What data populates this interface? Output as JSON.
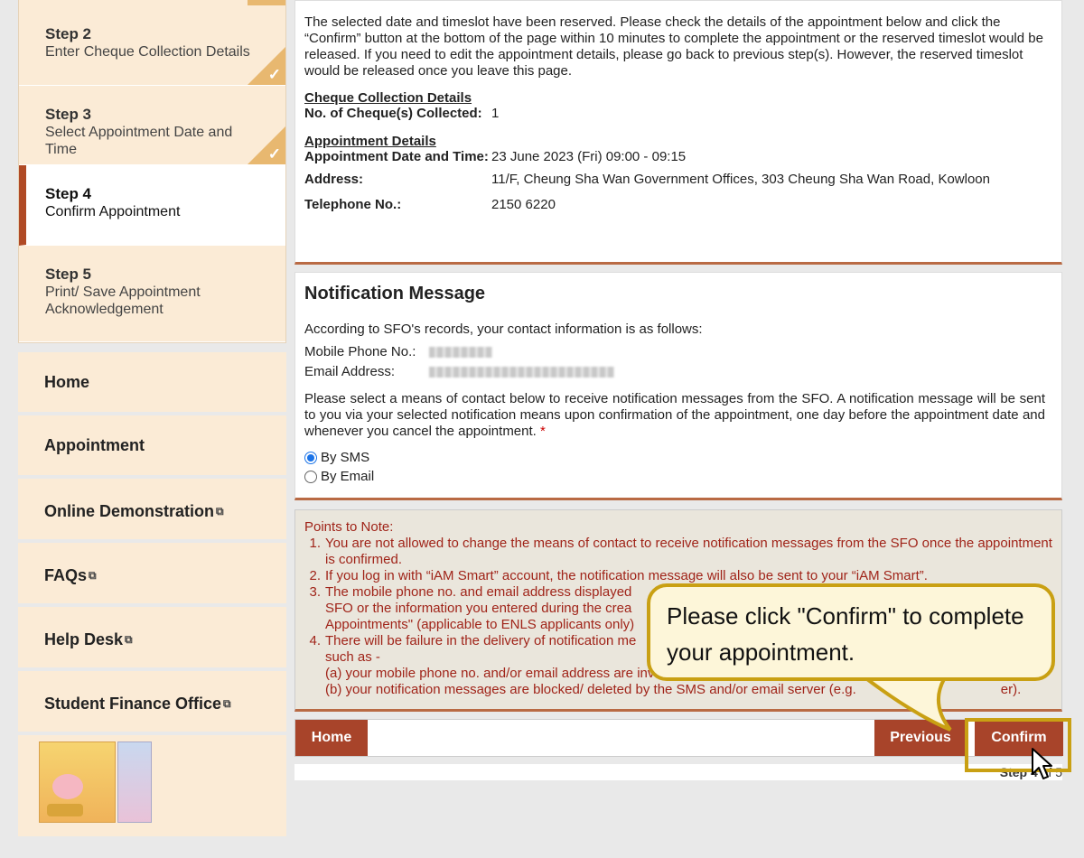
{
  "sidebar": {
    "steps": [
      {
        "num": "Step 2",
        "desc": "Enter Cheque Collection Details",
        "done": true
      },
      {
        "num": "Step 3",
        "desc": "Select Appointment Date and Time",
        "done": true
      },
      {
        "num": "Step 4",
        "desc": "Confirm Appointment",
        "active": true
      },
      {
        "num": "Step 5",
        "desc": "Print/ Save Appointment Acknowledgement"
      }
    ],
    "menu": {
      "home": "Home",
      "appointment": "Appointment",
      "demo": "Online Demonstration",
      "faqs": "FAQs",
      "help": "Help Desk",
      "sfo": "Student Finance Office"
    }
  },
  "main": {
    "intro": "The selected date and timeslot have been reserved. Please check the details of the appointment below and click the “Confirm” button at the bottom of the page within 10 minutes to complete the appointment or the reserved timeslot would be released. If you need to edit the appointment details, please go back to previous step(s). However, the reserved timeslot would be released once you leave this page.",
    "cheque_title": "Cheque Collection Details",
    "cheque_label": "No. of Cheque(s) Collected:",
    "cheque_value": "1",
    "appt_title": "Appointment Details",
    "date_label": "Appointment Date and Time:",
    "date_value": "23 June 2023 (Fri) 09:00 - 09:15",
    "address_label": "Address:",
    "address_value": "11/F, Cheung Sha Wan Government Offices, 303 Cheung Sha Wan Road, Kowloon",
    "tel_label": "Telephone No.:",
    "tel_value": "2150 6220"
  },
  "notification": {
    "title": "Notification Message",
    "records": "According to SFO's records, your contact information is as follows:",
    "mobile_label": "Mobile Phone No.:",
    "email_label": "Email Address:",
    "instruction": "Please select a means of contact below to receive notification messages from the SFO. A notification message will be sent to you via your selected notification means upon confirmation of the appointment, one day before the appointment date and whenever you cancel the appointment.",
    "required_mark": "*",
    "option_sms": "By SMS",
    "option_email": "By Email"
  },
  "notes": {
    "heading": "Points to Note:",
    "items": [
      {
        "num": "1.",
        "text": "You are not allowed to change the means of contact to receive notification messages from the SFO once the appointment is confirmed."
      },
      {
        "num": "2.",
        "text": "If you log in with “iAM Smart” account, the notification message will also be sent to your “iAM Smart”."
      },
      {
        "num": "3.",
        "text": "The mobile phone no. and email address displayed"
      },
      {
        "num": "",
        "text": "SFO or the information you entered during the crea"
      },
      {
        "num": "",
        "text": "Appointments\" (applicable to ENLS applicants only)"
      },
      {
        "num": "4.",
        "text": "There will be failure in the delivery of notification me"
      },
      {
        "num": "",
        "text": "such as -"
      },
      {
        "num": "",
        "text": "(a)  your mobile phone no. and/or email address are invalid/ incorrect; or"
      },
      {
        "num": "",
        "text": "(b)  your notification messages are blocked/ deleted by the SMS and/or email server (e.g."
      }
    ],
    "tail_fragment": "er)."
  },
  "buttons": {
    "home": "Home",
    "previous": "Previous",
    "confirm": "Confirm"
  },
  "step_indicator": {
    "bold": "Step 4",
    "rest": " of 5"
  },
  "callout": {
    "text": "Please click \"Confirm\" to complete your appointment."
  }
}
